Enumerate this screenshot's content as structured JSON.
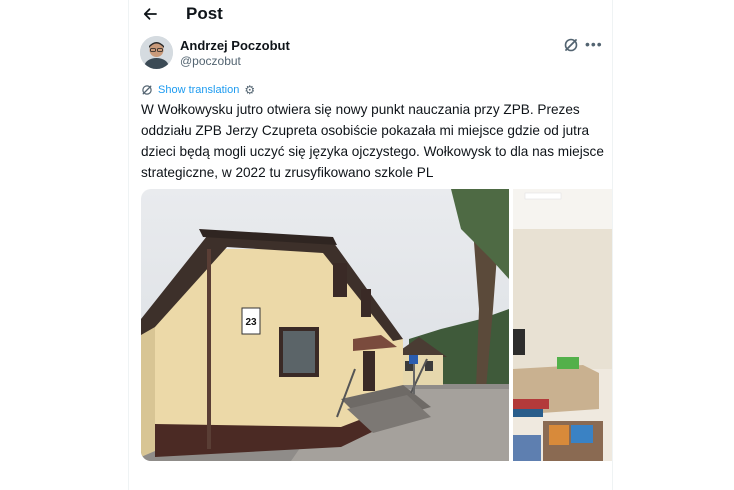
{
  "header": {
    "title": "Post"
  },
  "author": {
    "name": "Andrzej Poczobut",
    "handle": "@poczobut"
  },
  "post": {
    "translate_label": "Show translation",
    "text": "W Wołkowysku jutro otwiera się nowy punkt nauczania przy ZPB. Prezes oddziału ZPB Jerzy Czupreta osobiście pokazała mi miejsce gdzie od jutra dzieci będą mogli uczyć się języka ojczystego. Wołkowysk to dla nas miejsce strategiczne, w 2022 tu zrusyfikowano szkole PL"
  },
  "media": {
    "house_number": "23"
  },
  "icons": {
    "back": "arrow-left-icon",
    "grok": "grok-icon",
    "more": "more-icon",
    "translate": "translate-icon",
    "settings": "gear-icon"
  },
  "colors": {
    "accent": "#1d9bf0",
    "text": "#0f1419",
    "muted": "#536471"
  }
}
